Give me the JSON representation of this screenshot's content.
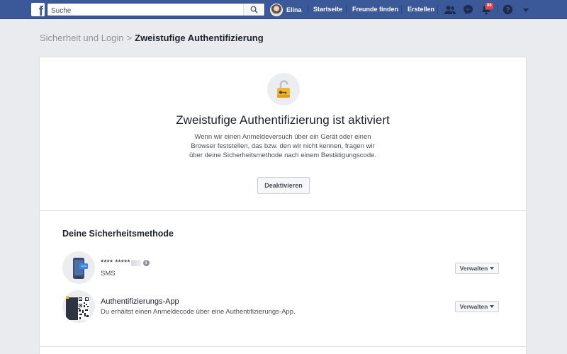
{
  "topbar": {
    "logo": "f",
    "search_placeholder": "Suche",
    "user_name": "Elina",
    "nav": [
      "Startseite",
      "Freunde finden",
      "Erstellen"
    ],
    "notification_count": "86",
    "icons": [
      "search-icon",
      "friend-requests-icon",
      "messenger-icon",
      "notifications-icon",
      "help-icon",
      "account-menu-icon"
    ]
  },
  "breadcrumb": {
    "parent": "Sicherheit und Login",
    "separator": ">",
    "current": "Zweistufige Authentifizierung"
  },
  "hero": {
    "icon": "lock-key-icon",
    "title": "Zweistufige Authentifizierung ist aktiviert",
    "description": "Wenn wir einen Anmeldeversuch über ein Gerät oder einen Browser feststellen, das bzw. den wir nicht kennen, fragen wir über deine Sicherheitsmethode nach einem Bestätigungscode.",
    "button": "Deaktivieren"
  },
  "methods": {
    "title": "Deine Sicherheitsmethode",
    "items": [
      {
        "title": "**** *****",
        "subtitle": "SMS",
        "button": "Verwalten",
        "icon": "phone-sms-icon"
      },
      {
        "title": "Authentifizierungs-App",
        "subtitle": "Du erhältst einen Anmeldecode über eine Authentifizierungs-App.",
        "button": "Verwalten",
        "icon": "qr-code-phone-icon"
      }
    ]
  },
  "colors": {
    "brand": "#3b5998",
    "badge": "#fa3e3e",
    "lock": "#f5b829"
  }
}
